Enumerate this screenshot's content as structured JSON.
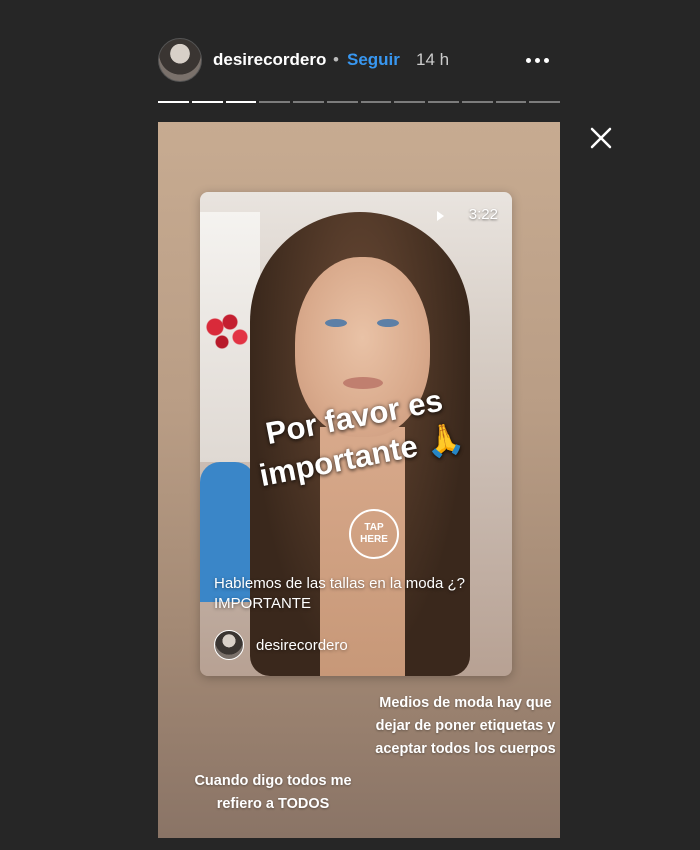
{
  "header": {
    "username": "desirecordero",
    "separator": "•",
    "follow_label": "Seguir",
    "time": "14 h",
    "more_icon": "more-horizontal-icon"
  },
  "progress": {
    "segments": 12,
    "current": 3
  },
  "close_icon": "close-icon",
  "story": {
    "caption": "Por favor es importante 🙏",
    "post": {
      "duration": "3:22",
      "play_icon": "play-icon",
      "tap_here_line1": "TAP",
      "tap_here_line2": "HERE",
      "title": "Hablemos de las tallas en la moda ¿? IMPORTANTE",
      "author": "desirecordero"
    },
    "note_right": "Medios de moda hay que dejar de poner etiquetas y aceptar todos los cuerpos",
    "note_left": "Cuando digo todos me refiero a TODOS"
  }
}
